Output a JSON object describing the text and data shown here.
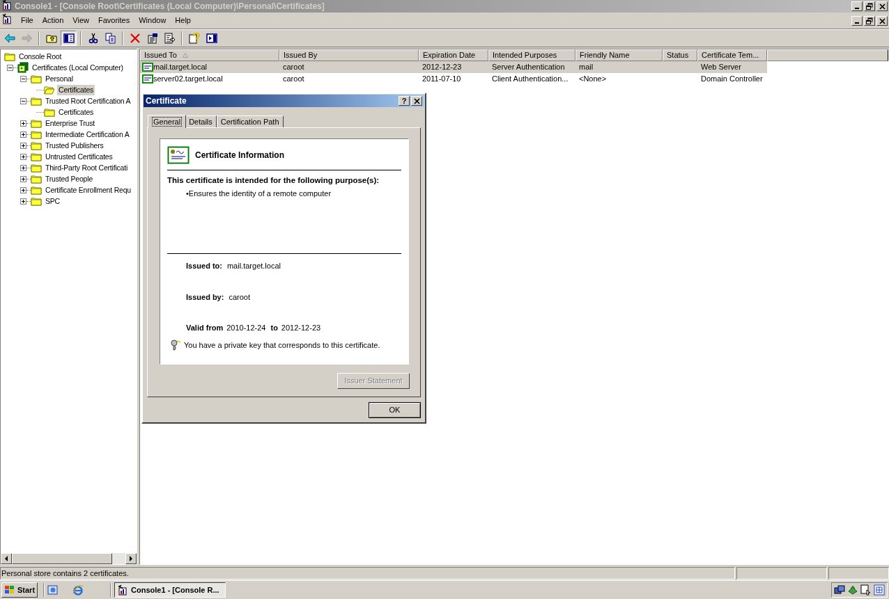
{
  "window": {
    "title": "Console1 - [Console Root\\Certificates (Local Computer)\\Personal\\Certificates]"
  },
  "menu": [
    {
      "label": "File"
    },
    {
      "label": "Action"
    },
    {
      "label": "View"
    },
    {
      "label": "Favorites"
    },
    {
      "label": "Window"
    },
    {
      "label": "Help"
    }
  ],
  "toolbar": [
    {
      "kind": "back",
      "disabled": false,
      "pressed": false
    },
    {
      "kind": "forward",
      "disabled": true,
      "pressed": false
    },
    {
      "kind": "up",
      "disabled": false,
      "pressed": false
    },
    {
      "kind": "tree",
      "disabled": false,
      "pressed": true
    },
    {
      "kind": "cut",
      "disabled": false,
      "pressed": false
    },
    {
      "kind": "copy",
      "disabled": false,
      "pressed": false
    },
    {
      "kind": "delete",
      "disabled": false,
      "pressed": false
    },
    {
      "kind": "properties",
      "disabled": false,
      "pressed": false
    },
    {
      "kind": "export",
      "disabled": false,
      "pressed": false
    },
    {
      "kind": "help",
      "disabled": false,
      "pressed": false
    },
    {
      "kind": "pane",
      "disabled": false,
      "pressed": false
    }
  ],
  "tree": [
    {
      "label": "Console Root",
      "kind": "root",
      "selected": false,
      "children": [
        {
          "label": "Certificates (Local Computer)",
          "kind": "snapin",
          "expanded": true,
          "selected": false,
          "children": [
            {
              "label": "Personal",
              "kind": "folder",
              "expanded": true,
              "selected": false,
              "children": [
                {
                  "label": "Certificates",
                  "kind": "folder",
                  "selected": true
                }
              ]
            },
            {
              "label": "Trusted Root Certification A",
              "kind": "folder",
              "expanded": true,
              "selected": false,
              "children": [
                {
                  "label": "Certificates",
                  "kind": "folder",
                  "selected": false
                }
              ]
            },
            {
              "label": "Enterprise Trust",
              "kind": "folder",
              "expanded": false,
              "selected": false
            },
            {
              "label": "Intermediate Certification A",
              "kind": "folder",
              "expanded": false,
              "selected": false
            },
            {
              "label": "Trusted Publishers",
              "kind": "folder",
              "expanded": false,
              "selected": false
            },
            {
              "label": "Untrusted Certificates",
              "kind": "folder",
              "expanded": false,
              "selected": false
            },
            {
              "label": "Third-Party Root Certificati",
              "kind": "folder",
              "expanded": false,
              "selected": false
            },
            {
              "label": "Trusted People",
              "kind": "folder",
              "expanded": false,
              "selected": false
            },
            {
              "label": "Certificate Enrollment Requ",
              "kind": "folder",
              "expanded": false,
              "selected": false
            },
            {
              "label": "SPC",
              "kind": "folder",
              "expanded": false,
              "selected": false
            }
          ]
        }
      ]
    }
  ],
  "table": {
    "columns": [
      {
        "label": "Issued To",
        "sorted": true
      },
      {
        "label": "Issued By",
        "sorted": false
      },
      {
        "label": "Expiration Date",
        "sorted": false
      },
      {
        "label": "Intended Purposes",
        "sorted": false
      },
      {
        "label": "Friendly Name",
        "sorted": false
      },
      {
        "label": "Status",
        "sorted": false
      },
      {
        "label": "Certificate Tem...",
        "sorted": false
      }
    ],
    "rows": [
      {
        "selected": true,
        "cells": [
          "mail.target.local",
          "caroot",
          "2012-12-23",
          "Server Authentication",
          "mail",
          "",
          "Web Server"
        ]
      },
      {
        "selected": false,
        "cells": [
          "server02.target.local",
          "caroot",
          "2011-07-10",
          "Client Authentication...",
          "<None>",
          "",
          "Domain Controller"
        ]
      }
    ]
  },
  "dialog": {
    "title": "Certificate",
    "help_button": "?",
    "tabs": [
      {
        "label": "General",
        "selected": true
      },
      {
        "label": "Details",
        "selected": false
      },
      {
        "label": "Certification Path",
        "selected": false
      }
    ],
    "heading": "Certificate Information",
    "purpose_heading": "This certificate is intended for the following purpose(s):",
    "purposes": [
      "•Ensures the identity of a remote computer"
    ],
    "issued_to": {
      "label": "Issued to:",
      "value": "mail.target.local"
    },
    "issued_by": {
      "label": "Issued by:",
      "value": "caroot"
    },
    "valid": {
      "from_label": "Valid from",
      "from": "2010-12-24",
      "to_label": "to",
      "to": "2012-12-23"
    },
    "key_note": "You have a private key that corresponds to this certificate.",
    "buttons": [
      {
        "label": "Issuer Statement",
        "disabled": true
      },
      {
        "label": "OK",
        "disabled": false
      }
    ]
  },
  "status_bar": {
    "text": "Personal store contains 2 certificates."
  },
  "taskbar": {
    "start": "Start",
    "task": "Console1 - [Console R..."
  }
}
